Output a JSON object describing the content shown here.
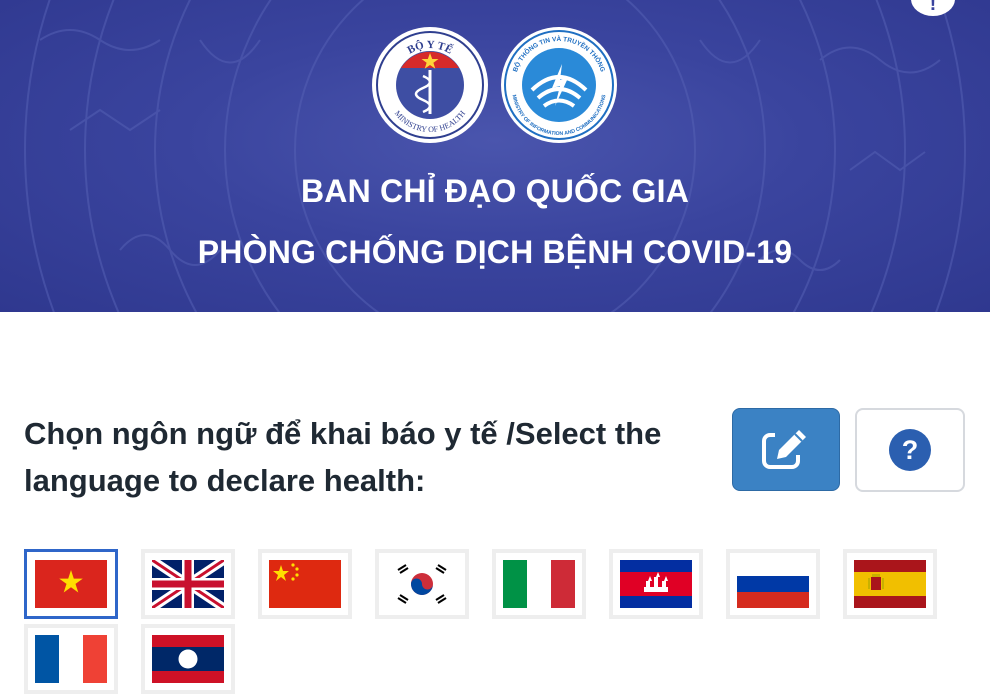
{
  "banner": {
    "title_line1": "BAN CHỈ ĐẠO QUỐC GIA",
    "title_line2": "PHÒNG CHỐNG DỊCH BỆNH COVID-19",
    "logo_moh": {
      "top_text": "BỘ Y TẾ",
      "bottom_text": "MINISTRY OF HEALTH"
    },
    "logo_mic": {
      "top_text": "BỘ THÔNG TIN VÀ TRUYỀN THÔNG",
      "bottom_text": "MINISTRY OF INFORMATION AND COMMUNICATIONS"
    }
  },
  "prompt": {
    "text": "Chọn ngôn ngữ để khai báo y tế /Select the language to declare health:"
  },
  "buttons": {
    "edit_icon": "edit-icon",
    "help_icon": "question-circle-icon"
  },
  "languages": [
    {
      "flag": "vietnam",
      "selected": true
    },
    {
      "flag": "united-kingdom",
      "selected": false
    },
    {
      "flag": "china",
      "selected": false
    },
    {
      "flag": "south-korea",
      "selected": false
    },
    {
      "flag": "italy",
      "selected": false
    },
    {
      "flag": "cambodia",
      "selected": false
    },
    {
      "flag": "russia",
      "selected": false
    },
    {
      "flag": "spain",
      "selected": false
    },
    {
      "flag": "france",
      "selected": false
    },
    {
      "flag": "laos",
      "selected": false
    }
  ],
  "colors": {
    "banner": "#3a449e",
    "primary_button": "#3b82c4",
    "help_icon": "#2b5fb0",
    "selected_border": "#2f66c9"
  }
}
